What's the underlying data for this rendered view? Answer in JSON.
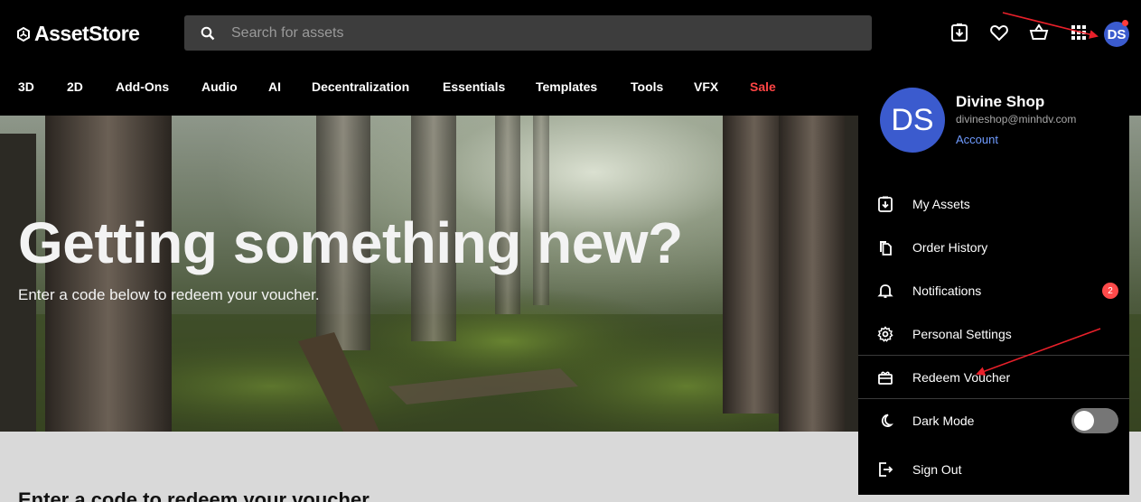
{
  "header": {
    "logo_text": "AssetStore",
    "search_placeholder": "Search for assets",
    "avatar_initials": "DS"
  },
  "nav": {
    "items": [
      "3D",
      "2D",
      "Add-Ons",
      "Audio",
      "AI",
      "Decentralization",
      "Essentials",
      "Templates",
      "Tools",
      "VFX",
      "Sale"
    ]
  },
  "hero": {
    "title": "Getting something new?",
    "subtitle": "Enter a code below to redeem your voucher."
  },
  "section": {
    "title": "Enter a code to redeem your voucher"
  },
  "dropdown": {
    "avatar_initials": "DS",
    "user_name": "Divine Shop",
    "user_email": "divineshop@minhdv.com",
    "account_label": "Account",
    "items": [
      {
        "label": "My Assets",
        "icon": "download-box-icon"
      },
      {
        "label": "Order History",
        "icon": "copy-pages-icon"
      },
      {
        "label": "Notifications",
        "icon": "bell-icon",
        "badge": "2"
      },
      {
        "label": "Personal Settings",
        "icon": "gear-icon"
      },
      {
        "label": "Redeem Voucher",
        "icon": "gift-voucher-icon"
      },
      {
        "label": "Dark Mode",
        "icon": "moon-icon"
      },
      {
        "label": "Sign Out",
        "icon": "sign-out-icon"
      }
    ],
    "dark_mode_on": false
  },
  "colors": {
    "accent": "#3b5bce",
    "sale": "#ff4545",
    "badge": "#ff4a4a",
    "link": "#6f9bff",
    "annotation_arrow": "#e8202a"
  }
}
